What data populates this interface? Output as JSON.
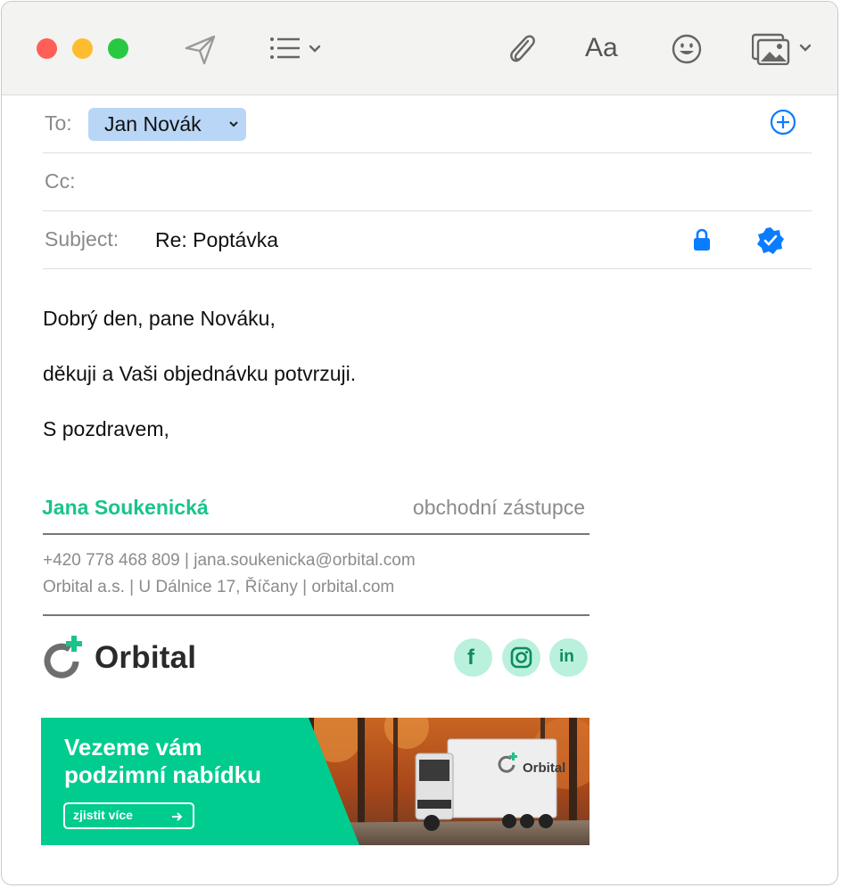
{
  "toolbar": {
    "icons": [
      "send-icon",
      "list-format-icon",
      "attachment-icon",
      "font-format-icon",
      "emoji-icon",
      "photo-browser-icon"
    ],
    "font_label": "Aa"
  },
  "header": {
    "to_label": "To:",
    "to_recipient": "Jan Novák",
    "cc_label": "Cc:",
    "subject_label": "Subject:",
    "subject_value": "Re: Poptávka"
  },
  "message": {
    "greeting": "Dobrý den, pane Nováku,",
    "line1": "děkuji a Vaši objednávku potvrzuji.",
    "closing": "S pozdravem,"
  },
  "signature": {
    "name": "Jana Soukenická",
    "role": "obchodní zástupce",
    "contact_line": "+420 778 468 809 | jana.soukenicka@orbital.com",
    "address_line": "Orbital a.s. | U Dálnice 17, Říčany | orbital.com",
    "company": "Orbital",
    "social": [
      "f",
      "in"
    ]
  },
  "banner": {
    "title_line1": "Vezeme vám",
    "title_line2": "podzimní nabídku",
    "button_label": "zjistit více",
    "truck_logo": "Orbital"
  },
  "colors": {
    "brand_green": "#19c489",
    "banner_green": "#00cc8f",
    "accent_blue": "#0a7cff",
    "chip_blue": "#b9d6f7"
  }
}
